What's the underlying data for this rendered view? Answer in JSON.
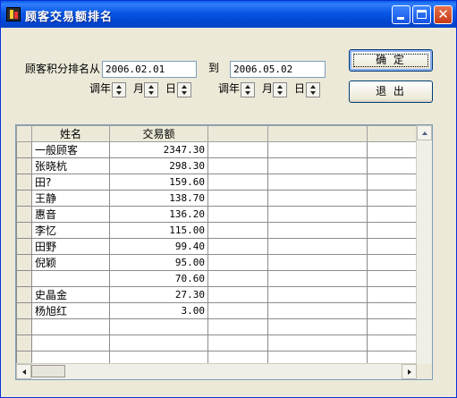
{
  "window": {
    "title": "顾客交易额排名",
    "close_glyph": "✕"
  },
  "form": {
    "label_from": "顾客积分排名从",
    "start_date": "2006.02.01",
    "label_to": "到",
    "end_date": "2006.05.02",
    "adjust": {
      "year": "调年",
      "month": "月",
      "day": "日"
    }
  },
  "buttons": {
    "ok": "确 定",
    "exit": "退 出"
  },
  "table": {
    "columns": [
      "姓名",
      "交易额",
      "",
      "",
      ""
    ],
    "rows": [
      {
        "name": "一般顾客",
        "amount": "2347.30"
      },
      {
        "name": "张晓杭",
        "amount": "298.30"
      },
      {
        "name": "田?",
        "amount": "159.60"
      },
      {
        "name": "王静",
        "amount": "138.70"
      },
      {
        "name": "惠音",
        "amount": "136.20"
      },
      {
        "name": "李忆",
        "amount": "115.00"
      },
      {
        "name": "田野",
        "amount": "99.40"
      },
      {
        "name": "倪颖",
        "amount": "95.00"
      },
      {
        "name": "",
        "amount": "70.60"
      },
      {
        "name": "史晶金",
        "amount": "27.30"
      },
      {
        "name": "杨旭红",
        "amount": "3.00"
      },
      {
        "name": "",
        "amount": ""
      },
      {
        "name": "",
        "amount": ""
      },
      {
        "name": "",
        "amount": ""
      }
    ]
  }
}
